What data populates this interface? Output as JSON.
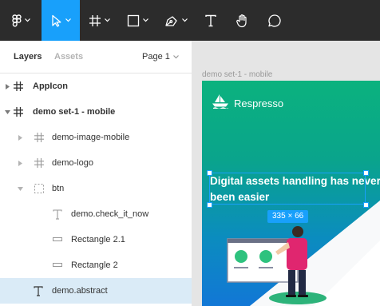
{
  "toolbar": {
    "tools": [
      "figma-menu",
      "move-tool",
      "frame-tool",
      "shape-tool",
      "pen-tool",
      "text-tool",
      "hand-tool",
      "comment-tool"
    ],
    "active_tool": "move-tool",
    "accent": "#18a0fb"
  },
  "panel": {
    "tab_layers": "Layers",
    "tab_assets": "Assets",
    "page_label": "Page 1"
  },
  "layers": [
    {
      "label": "AppIcon",
      "icon": "frame-icon",
      "indent": 0
    },
    {
      "label": "demo set-1 - mobile",
      "icon": "frame-icon",
      "indent": 0
    },
    {
      "label": "demo-image-mobile",
      "icon": "frame-icon",
      "indent": 1
    },
    {
      "label": "demo-logo",
      "icon": "frame-icon",
      "indent": 1
    },
    {
      "label": "btn",
      "icon": "group-icon",
      "indent": 1
    },
    {
      "label": "demo.check_it_now",
      "icon": "text-icon",
      "indent": 2
    },
    {
      "label": "Rectangle 2.1",
      "icon": "rectangle-icon",
      "indent": 2
    },
    {
      "label": "Rectangle 2",
      "icon": "rectangle-icon",
      "indent": 2
    },
    {
      "label": "demo.abstract",
      "icon": "text-icon",
      "indent": 1
    }
  ],
  "canvas": {
    "frame_title": "demo set-1 - mobile",
    "brand_name": "Respresso",
    "headline": "Digital assets handling has never been easier",
    "selection_size": "335 × 66"
  }
}
